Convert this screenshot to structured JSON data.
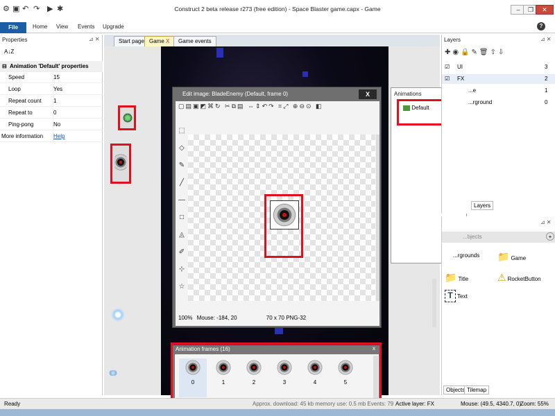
{
  "window": {
    "title": "Construct 2 beta release r273  (free edition) - Space Blaster game.capx - Game",
    "minimize_label": "–",
    "restore_label": "❐",
    "close_label": "✕"
  },
  "ribbon": {
    "file_label": "File",
    "tabs": [
      "Home",
      "View",
      "Events",
      "Upgrade"
    ],
    "help_label": "?"
  },
  "properties": {
    "title": "Properties",
    "sort_label": "A↓Z",
    "section_title": "Animation 'Default' properties",
    "rows": [
      {
        "key": "Speed",
        "value": "15"
      },
      {
        "key": "Loop",
        "value": "Yes"
      },
      {
        "key": "Repeat count",
        "value": "1"
      },
      {
        "key": "Repeat to",
        "value": "0"
      },
      {
        "key": "Ping-pong",
        "value": "No"
      }
    ],
    "more_info_label": "More information",
    "more_info_link": "Help"
  },
  "document_tabs": [
    {
      "label": "Start page"
    },
    {
      "label": "Game",
      "close": "X"
    },
    {
      "label": "Game events"
    }
  ],
  "edit_image": {
    "title": "Edit image: BladeEnemy (Default, frame 0)",
    "close_label": "X",
    "zoom": "100%",
    "mouse": "Mouse: -184, 20",
    "size_format": "70 x 70  PNG-32"
  },
  "animations": {
    "title": "Animations",
    "items": [
      "Default"
    ]
  },
  "layers": {
    "title": "Layers",
    "rows": [
      {
        "name": "UI",
        "index": "3",
        "checked": true
      },
      {
        "name": "FX",
        "index": "2",
        "checked": true
      },
      {
        "name": "...e",
        "index": "1",
        "checked": false
      },
      {
        "name": "...rground",
        "index": "0",
        "checked": false
      }
    ],
    "bottom_tab": "Layers"
  },
  "objects": {
    "header": "...bjects",
    "items": [
      "...rgrounds",
      "Game",
      "Title",
      "RocketButton",
      "Text"
    ],
    "tabs": [
      "Objects",
      "Tilemap"
    ]
  },
  "animation_frames": {
    "title": "Animation frames (16)",
    "close_label": "x",
    "frames": [
      "0",
      "1",
      "2",
      "3",
      "4",
      "5"
    ]
  },
  "statusbar": {
    "ready": "Ready",
    "middle": "Approx. download: 45 kb  memory use: 0.5 mb  Events: 79",
    "active_layer": "Active layer: FX",
    "mouse": "Mouse: (49.5, 4340.7, 0)",
    "zoom": "Zoom: 55%"
  },
  "colors": {
    "file_tab": "#1c5ea5",
    "highlight_box": "#e01020",
    "dialog_frame": "#6f6f6f"
  }
}
